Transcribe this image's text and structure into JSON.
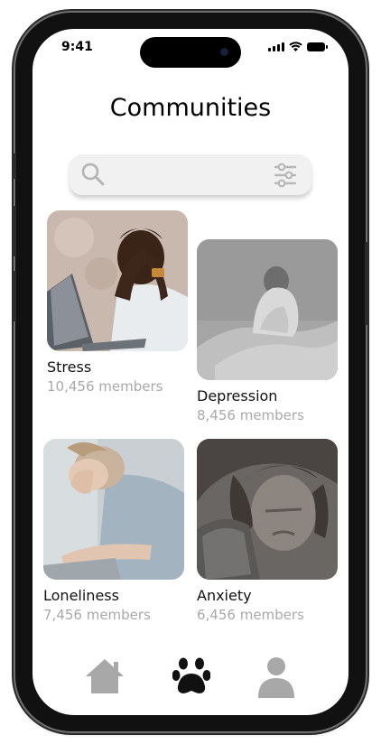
{
  "status": {
    "time": "9:41"
  },
  "page": {
    "title": "Communities"
  },
  "search": {
    "placeholder": "",
    "value": "",
    "search_icon": "search-icon",
    "filter_icon": "filter-sliders-icon"
  },
  "communities": [
    {
      "name": "Stress",
      "members": "10,456 members"
    },
    {
      "name": "Depression",
      "members": "8,456 members"
    },
    {
      "name": "Loneliness",
      "members": "7,456 members"
    },
    {
      "name": "Anxiety",
      "members": "6,456 members"
    }
  ],
  "nav": [
    {
      "icon": "home-icon",
      "active": false
    },
    {
      "icon": "paw-icon",
      "active": true
    },
    {
      "icon": "profile-icon",
      "active": false
    }
  ],
  "colors": {
    "active": "#111111",
    "inactive": "#a8a8a8",
    "muted_text": "#a9a9a9",
    "search_bg": "#f1f1f1"
  }
}
